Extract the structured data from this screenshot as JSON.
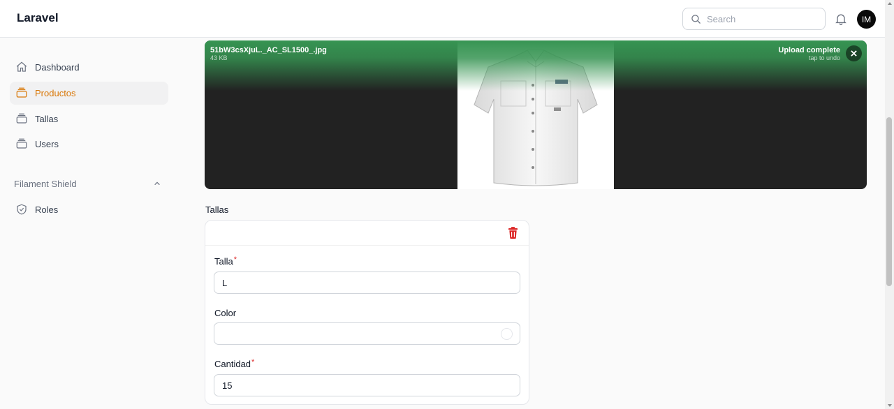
{
  "app": {
    "brand": "Laravel"
  },
  "header": {
    "search_placeholder": "Search",
    "avatar_initials": "IM"
  },
  "sidebar": {
    "items": [
      {
        "label": "Dashboard",
        "icon": "home-icon",
        "active": false
      },
      {
        "label": "Productos",
        "icon": "inbox-stack-icon",
        "active": true
      },
      {
        "label": "Tallas",
        "icon": "inbox-stack-icon",
        "active": false
      },
      {
        "label": "Users",
        "icon": "inbox-stack-icon",
        "active": false
      }
    ],
    "group": {
      "label": "Filament Shield",
      "icon": "chevron-up-icon",
      "items": [
        {
          "label": "Roles",
          "icon": "shield-check-icon"
        }
      ]
    }
  },
  "upload": {
    "file_name": "51bW3csXjuL._AC_SL1500_.jpg",
    "file_size": "43 KB",
    "status": "Upload complete",
    "undo_hint": "tap to undo",
    "progress": 1.0,
    "status_color": "#369452"
  },
  "tallas": {
    "section_label": "Tallas",
    "fields": {
      "talla": {
        "label": "Talla",
        "required": "*",
        "value": "L"
      },
      "color": {
        "label": "Color",
        "value": ""
      },
      "cantidad": {
        "label": "Cantidad",
        "required": "*",
        "value": "15"
      }
    }
  },
  "colors": {
    "accent": "#d97706",
    "danger": "#dc2626"
  }
}
